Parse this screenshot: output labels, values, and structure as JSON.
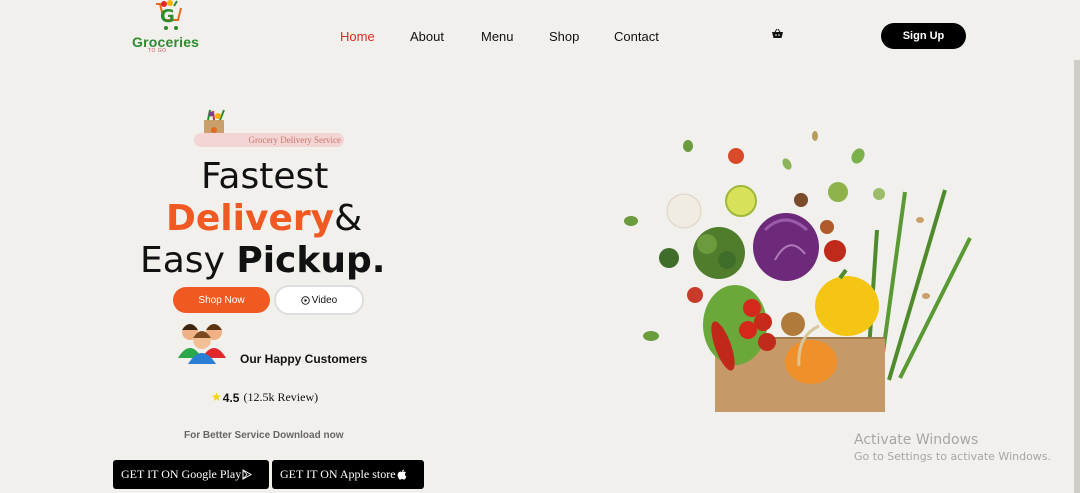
{
  "brand": {
    "name": "Groceries",
    "tagline": "TO GO"
  },
  "nav": {
    "items": [
      "Home",
      "About",
      "Menu",
      "Shop",
      "Contact"
    ],
    "active": "Home",
    "active_color": "#e0282a"
  },
  "header": {
    "signup_label": "Sign Up",
    "cart_icon": "basket-icon"
  },
  "hero": {
    "badge": "Grocery Delivery Service",
    "line1": "Fastest",
    "line2_highlight": "Delivery",
    "line2_amp": "&",
    "line3_plain": "Easy ",
    "line3_bold": "Pickup.",
    "accent_color": "#f05a22",
    "shop_label": "Shop Now",
    "video_label": "Video",
    "customers_label": "Our Happy Customers",
    "rating_score": "4.5",
    "rating_reviews": "(12.5k Review)",
    "download_note": "For Better Service Download now",
    "google_play_label": "GET IT ON Google Play",
    "apple_store_label": "GET IT ON Apple store"
  },
  "watermark": {
    "title": "Activate Windows",
    "subtitle": "Go to Settings to activate Windows."
  }
}
